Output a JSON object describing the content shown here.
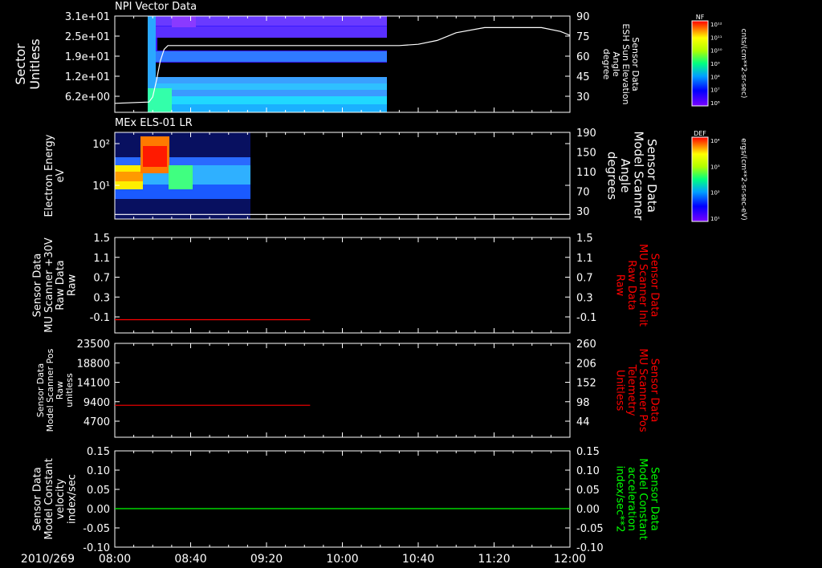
{
  "chart_data": {
    "date_label": "2010/269",
    "x_tick_labels": [
      "08:00",
      "08:40",
      "09:20",
      "10:00",
      "10:40",
      "11:20",
      "12:00"
    ],
    "x_range": [
      "08:00",
      "12:00"
    ],
    "panels": [
      {
        "id": "p1",
        "type": "heatmap",
        "title": "NPI Vector Data",
        "left_label_lines": [
          "Sector",
          "Unitless"
        ],
        "right_label_lines": [
          "Sensor Data",
          "ESH Sun Elevation",
          "Angle",
          "degree"
        ],
        "left_ticks": [
          "3.1e+01",
          "2.5e+01",
          "1.9e+01",
          "1.2e+01",
          "6.2e+00"
        ],
        "right_ticks": [
          "90",
          "75",
          "60",
          "45",
          "30"
        ],
        "right_range": [
          15,
          90
        ],
        "line_color": "#ffffff",
        "line_series": {
          "x_minutes": [
            0,
            18,
            20,
            22,
            24,
            26,
            28,
            30,
            36,
            60,
            120,
            150,
            160,
            170,
            180,
            195,
            215,
            225,
            235,
            240
          ],
          "y": [
            22,
            23,
            27,
            40,
            55,
            64,
            67,
            67,
            67,
            67,
            67,
            67,
            68,
            71,
            77,
            81,
            81,
            81,
            78,
            75
          ]
        },
        "colorbar": {
          "title": "NF",
          "unit": "cnts/(cm**2-sr-sec)",
          "tick_labels": [
            "10¹²",
            "10¹¹",
            "10¹⁰",
            "10⁹",
            "10⁸",
            "10⁷",
            "10⁶"
          ]
        }
      },
      {
        "id": "p2",
        "type": "heatmap",
        "title": "MEx ELS-01 LR",
        "left_label_lines": [
          "Electron Energy",
          "eV"
        ],
        "right_label_lines": [
          "Sensor Data",
          "Model Scanner",
          "Angle",
          "degrees"
        ],
        "left_ticks": [
          "10²",
          "10¹"
        ],
        "right_ticks": [
          "190",
          "150",
          "110",
          "70",
          "30"
        ],
        "right_range": [
          0,
          190
        ],
        "line_color": "#ffffff",
        "line_series": {
          "x_minutes": [
            0,
            240
          ],
          "y": [
            10,
            10
          ]
        },
        "colorbar": {
          "title": "DEF",
          "unit": "ergs/(cm**2-sr-sec-eV)",
          "tick_labels": [
            "10⁴",
            "10³",
            "10²",
            "10¹"
          ]
        }
      },
      {
        "id": "p3",
        "type": "line",
        "left_label_lines": [
          "Sensor Data",
          "MU Scanner +30V",
          "Raw Data",
          "Raw"
        ],
        "right_label_lines": [
          "Sensor Data",
          "MU Scanner Init",
          "Raw Data",
          "Raw"
        ],
        "right_color": "#ff0000",
        "left_ticks": [
          "1.5",
          "1.1",
          "0.7",
          "0.3",
          "-0.1"
        ],
        "right_ticks": [
          "1.5",
          "1.1",
          "0.7",
          "0.3",
          "-0.1"
        ],
        "ylim": [
          -0.3,
          1.5
        ],
        "line_color": "#ff0000",
        "line_series": {
          "x_minutes": [
            0,
            103
          ],
          "y": [
            -0.05,
            -0.05
          ]
        }
      },
      {
        "id": "p4",
        "type": "line",
        "left_label_lines": [
          "Sensor Data",
          "Model Scanner Pos",
          "Raw",
          "unitless"
        ],
        "right_label_lines": [
          "Sensor Data",
          "MU Scanner Pos",
          "Telemetry",
          "Unitless"
        ],
        "right_color": "#ff0000",
        "left_ticks": [
          "23500",
          "18800",
          "14100",
          "9400",
          "4700"
        ],
        "right_ticks": [
          "260",
          "206",
          "152",
          "98",
          "44"
        ],
        "ylim": [
          0,
          23500
        ],
        "line_color": "#ff0000",
        "line_series": {
          "x_minutes": [
            0,
            103
          ],
          "y": [
            8000,
            8000
          ]
        }
      },
      {
        "id": "p5",
        "type": "line",
        "left_label_lines": [
          "Sensor Data",
          "Model Constant",
          "velocity",
          "index/sec"
        ],
        "right_label_lines": [
          "Sensor Data",
          "Model Constant",
          "acceleration",
          "index/sec**2"
        ],
        "right_color": "#00ff00",
        "left_ticks": [
          "0.15",
          "0.10",
          "0.05",
          "0.00",
          "-0.05",
          "-0.10"
        ],
        "right_ticks": [
          "0.15",
          "0.10",
          "0.05",
          "0.00",
          "-0.05",
          "-0.10"
        ],
        "ylim": [
          -0.1,
          0.15
        ],
        "line_color": "#00ff00",
        "line_series": {
          "x_minutes": [
            0,
            240
          ],
          "y": [
            0.0,
            0.0
          ]
        }
      }
    ]
  },
  "colors": {
    "background": "#000000",
    "axis": "#ffffff",
    "red": "#ff0000",
    "green": "#00ff00"
  }
}
